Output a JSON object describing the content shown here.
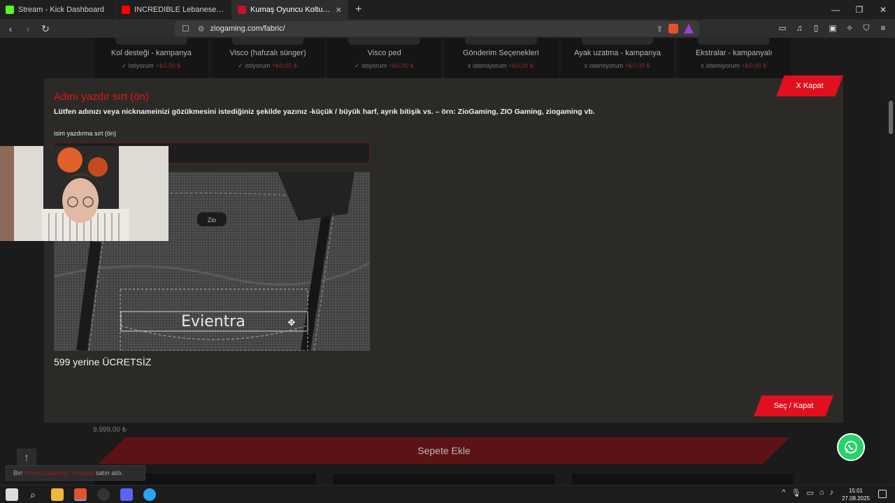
{
  "browser": {
    "tabs": [
      {
        "label": "Stream - Kick Dashboard",
        "icon": "kick-icon",
        "color": "#53fc18"
      },
      {
        "label": "INCREDIBLE Lebanese Wedding Entr...",
        "icon": "youtube-icon",
        "color": "#ff0000"
      },
      {
        "label": "Kumaş Oyuncu Koltuğu - Zio Ga...",
        "icon": "zio-icon",
        "color": "#c8102e",
        "active": true
      }
    ],
    "new_tab": "+",
    "url": "ziogaming.com/fabric/"
  },
  "options": [
    {
      "name": "Kol desteği - kampanya",
      "status": "✓ istiyorum",
      "price": "+₺0,00 ₺"
    },
    {
      "name": "Visco (hafızalı sünger)",
      "status": "✓ istiyorum",
      "price": "+₺0,00 ₺"
    },
    {
      "name": "Visco ped",
      "status": "✓ istiyorum",
      "price": "+₺0,00 ₺"
    },
    {
      "name": "Gönderim Seçenekleri",
      "status": "x istemiyorum",
      "price": "+₺0,00 ₺"
    },
    {
      "name": "Ayak uzatma - kampanya",
      "status": "x istemiyorum",
      "price": "+₺0,00 ₺"
    },
    {
      "name": "Ekstralar - kampanyalı",
      "status": "x istemiyorum",
      "price": "+₺0,00 ₺"
    }
  ],
  "modal": {
    "title": "Adını yazdır sırt (ön)",
    "description": "Lütfen adınızı veya nicknameinizi gözükmesini istediğiniz şekilde yazınız -küçük / büyük harf, ayrık bitişik vs. – örn: ZioGaming, ZIO Gaming, ziogaming vb.",
    "field_label": "isim yazdırma sırt (ön)",
    "field_value": "",
    "preview_text": "Evientra",
    "brand_patch": "Zio",
    "price_note": "599 yerine ÜCRETSİZ",
    "close_label": "X Kapat",
    "select_label": "Seç / Kapat"
  },
  "product": {
    "price": "9.999,00 ₺",
    "add_to_cart": "Sepete Ekle"
  },
  "toast": {
    "prefix": "Biri",
    "product": "Venom Gaming - Antrasit",
    "suffix": "satın aldı."
  },
  "taskbar": {
    "time": "15:01",
    "date": "27.08.2025"
  },
  "colors": {
    "accent": "#e0101e",
    "modal_bg": "#2b2a27",
    "page_bg": "#1b1b1b"
  }
}
